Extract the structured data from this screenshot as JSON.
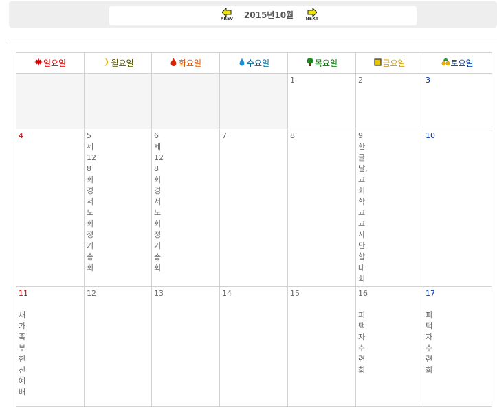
{
  "nav": {
    "month_title": "2015년10월",
    "prev_label": "PREV",
    "next_label": "NEXT"
  },
  "weekdays": [
    {
      "label": "일요일",
      "icon": "sun-icon",
      "color": "#cc0000"
    },
    {
      "label": "월요일",
      "icon": "moon-icon",
      "color": "#555500"
    },
    {
      "label": "화요일",
      "icon": "fire-icon",
      "color": "#dd5500"
    },
    {
      "label": "수요일",
      "icon": "water-drop-icon",
      "color": "#006699"
    },
    {
      "label": "목요일",
      "icon": "tree-icon",
      "color": "#007700"
    },
    {
      "label": "금요일",
      "icon": "gold-icon",
      "color": "#cc9900"
    },
    {
      "label": "토요일",
      "icon": "earth-icon",
      "color": "#003399"
    }
  ],
  "weeks": [
    [
      {
        "day": "",
        "event": ""
      },
      {
        "day": "",
        "event": ""
      },
      {
        "day": "",
        "event": ""
      },
      {
        "day": "",
        "event": ""
      },
      {
        "day": "1",
        "event": ""
      },
      {
        "day": "2",
        "event": ""
      },
      {
        "day": "3",
        "event": ""
      }
    ],
    [
      {
        "day": "4",
        "event": ""
      },
      {
        "day": "5",
        "event": "제128회경서노회정기총회"
      },
      {
        "day": "6",
        "event": "제128회경서노회정기총회"
      },
      {
        "day": "7",
        "event": ""
      },
      {
        "day": "8",
        "event": ""
      },
      {
        "day": "9",
        "event": "한글날,교회학교교사단합대회"
      },
      {
        "day": "10",
        "event": ""
      }
    ],
    [
      {
        "day": "11",
        "event": "새가족부헌신예배"
      },
      {
        "day": "12",
        "event": ""
      },
      {
        "day": "13",
        "event": ""
      },
      {
        "day": "14",
        "event": ""
      },
      {
        "day": "15",
        "event": ""
      },
      {
        "day": "16",
        "event": "피택자수련회"
      },
      {
        "day": "17",
        "event": "피택자수련회"
      }
    ]
  ]
}
